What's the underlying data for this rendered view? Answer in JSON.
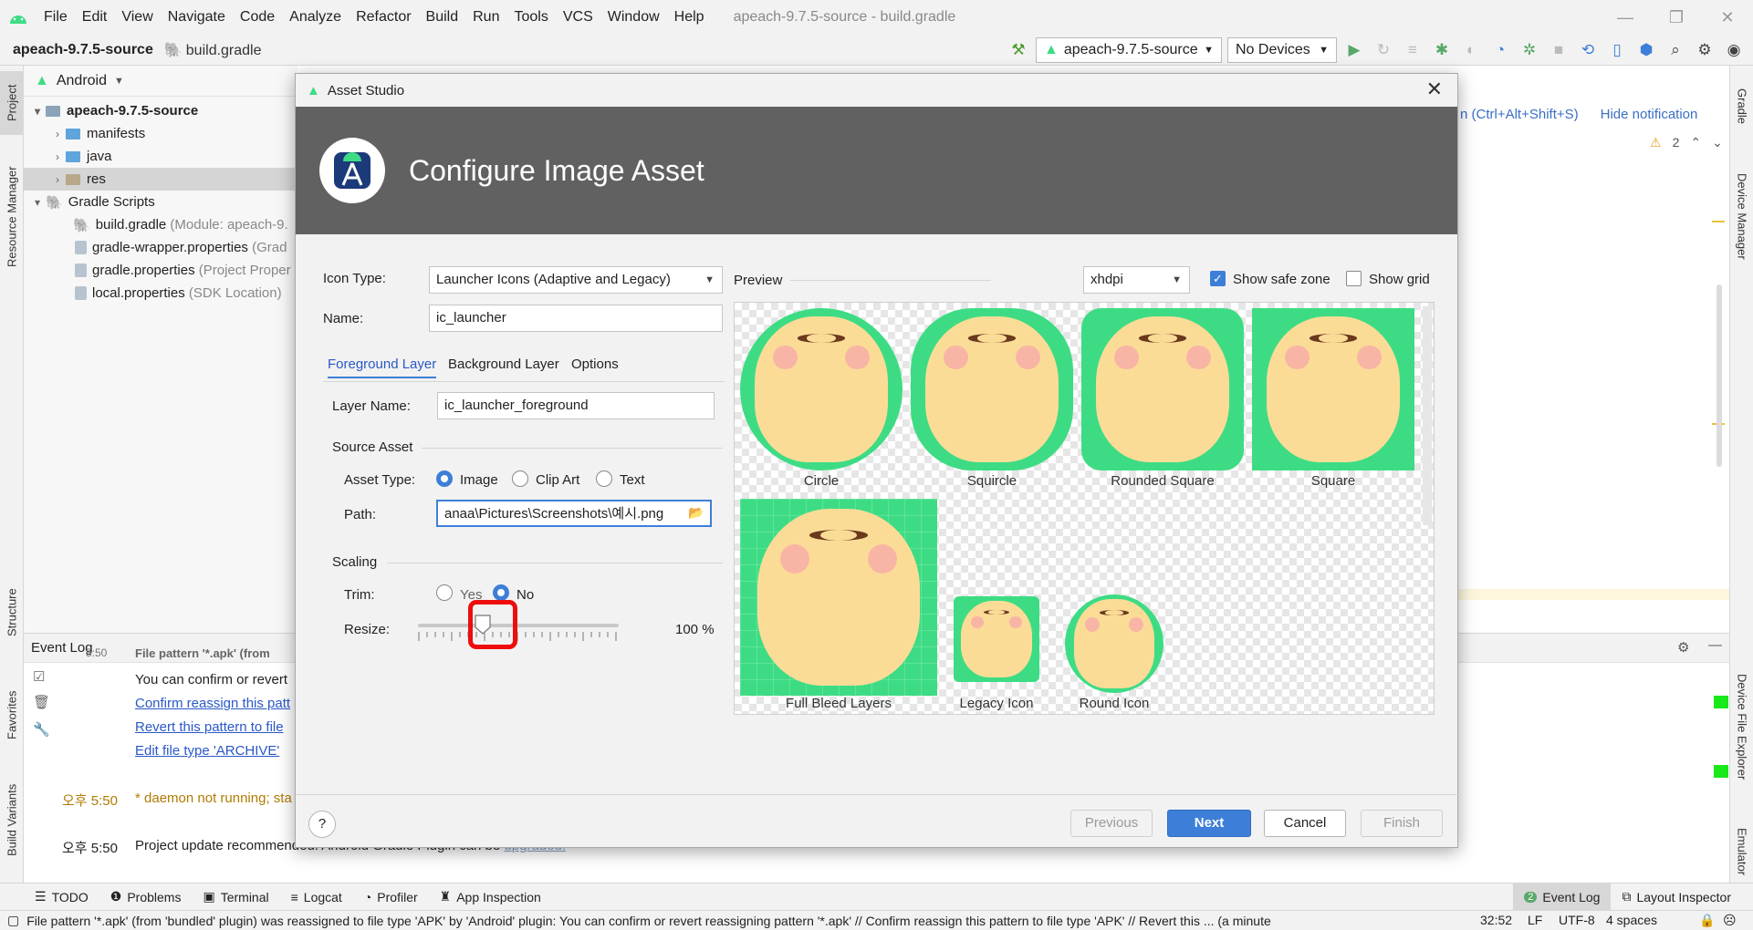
{
  "menu": {
    "items": [
      "File",
      "Edit",
      "View",
      "Navigate",
      "Code",
      "Analyze",
      "Refactor",
      "Build",
      "Run",
      "Tools",
      "VCS",
      "Window",
      "Help"
    ],
    "window_title": "apeach-9.7.5-source - build.gradle"
  },
  "navbar": {
    "project": "apeach-9.7.5-source",
    "file": "build.gradle",
    "run_config": "apeach-9.7.5-source",
    "device": "No Devices"
  },
  "project_panel": {
    "view": "Android",
    "tree": [
      {
        "label": "apeach-9.7.5-source",
        "hint": "",
        "indent": 0,
        "arrow": "v",
        "bold": true
      },
      {
        "label": "manifests",
        "hint": "",
        "indent": 1,
        "arrow": ">",
        "bold": false
      },
      {
        "label": "java",
        "hint": "",
        "indent": 1,
        "arrow": ">",
        "bold": false
      },
      {
        "label": "res",
        "hint": "",
        "indent": 1,
        "arrow": ">",
        "bold": false
      },
      {
        "label": "Gradle Scripts",
        "hint": "",
        "indent": 0,
        "arrow": "v",
        "bold": false
      },
      {
        "label": "build.gradle",
        "hint": "(Module: apeach-9.",
        "indent": 1,
        "arrow": "",
        "bold": false
      },
      {
        "label": "gradle-wrapper.properties",
        "hint": "(Grad",
        "indent": 1,
        "arrow": "",
        "bold": false
      },
      {
        "label": "gradle.properties",
        "hint": "(Project Proper",
        "indent": 1,
        "arrow": "",
        "bold": false
      },
      {
        "label": "local.properties",
        "hint": "(SDK Location)",
        "indent": 1,
        "arrow": "",
        "bold": false
      }
    ]
  },
  "left_strip": {
    "project": "Project",
    "resource_manager": "Resource Manager",
    "structure": "Structure",
    "favorites": "Favorites",
    "build_variants": "Build Variants"
  },
  "right_strip": {
    "gradle": "Gradle",
    "device_manager": "Device Manager",
    "device_file_explorer": "Device File Explorer",
    "emulator": "Emulator"
  },
  "notification": {
    "shortcut": "n (Ctrl+Alt+Shift+S)",
    "hide": "Hide notification",
    "warnings": "2"
  },
  "event_log": {
    "title": "Event Log",
    "cut_line": "File pattern '*.apk' (from",
    "cut_time": "5:50",
    "line_confirm_text": "You can confirm or revert",
    "link1": "Confirm reassign this patt",
    "link2": "Revert this pattern to file",
    "link3": "Edit file type 'ARCHIVE'",
    "time1": "오후 5:50",
    "msg1": "* daemon not running; sta",
    "time2": "오후 5:50",
    "msg2": "Project update recommended: Android Gradle Plugin can be",
    "msg2_link": "upgraded."
  },
  "bottom_tabs": [
    "TODO",
    "Problems",
    "Terminal",
    "Logcat",
    "Profiler",
    "App Inspection"
  ],
  "bottom_tabs_right": {
    "event_log": "Event Log",
    "event_count": "2",
    "layout_inspector": "Layout Inspector"
  },
  "status_bar": {
    "message": "File pattern '*.apk' (from 'bundled' plugin) was reassigned to file type 'APK' by 'Android' plugin: You can confirm or revert reassigning pattern '*.apk' // Confirm reassign this pattern to file type 'APK' // Revert this ... (a minute",
    "position": "32:52",
    "line_sep": "LF",
    "encoding": "UTF-8",
    "indent": "4 spaces"
  },
  "dialog": {
    "title": "Asset Studio",
    "header": "Configure Image Asset",
    "icon_type_label": "Icon Type:",
    "icon_type_value": "Launcher Icons (Adaptive and Legacy)",
    "name_label": "Name:",
    "name_value": "ic_launcher",
    "tabs": [
      "Foreground Layer",
      "Background Layer",
      "Options"
    ],
    "layer_name_label": "Layer Name:",
    "layer_name_value": "ic_launcher_foreground",
    "source_asset_label": "Source Asset",
    "asset_type_label": "Asset Type:",
    "asset_types": [
      "Image",
      "Clip Art",
      "Text"
    ],
    "asset_type_selected": "Image",
    "path_label": "Path:",
    "path_value": "anaa\\Pictures\\Screenshots\\예시.png",
    "scaling_label": "Scaling",
    "trim_label": "Trim:",
    "trim_yes": "Yes",
    "trim_no": "No",
    "trim_selected": "No",
    "resize_label": "Resize:",
    "resize_value": "100 %",
    "resize_percent": 100,
    "preview_label": "Preview",
    "density": "xhdpi",
    "show_safe_zone": "Show safe zone",
    "show_safe_zone_checked": true,
    "show_grid": "Show grid",
    "show_grid_checked": false,
    "previews": [
      "Circle",
      "Squircle",
      "Rounded Square",
      "Square",
      "Full Bleed Layers",
      "Legacy Icon",
      "Round Icon"
    ],
    "buttons": {
      "help": "?",
      "previous": "Previous",
      "next": "Next",
      "cancel": "Cancel",
      "finish": "Finish"
    }
  },
  "colors": {
    "accent": "#3d7fd8",
    "android_green": "#3ddc84",
    "bear": "#fbdc97",
    "highlight": "#ee0d0d"
  }
}
